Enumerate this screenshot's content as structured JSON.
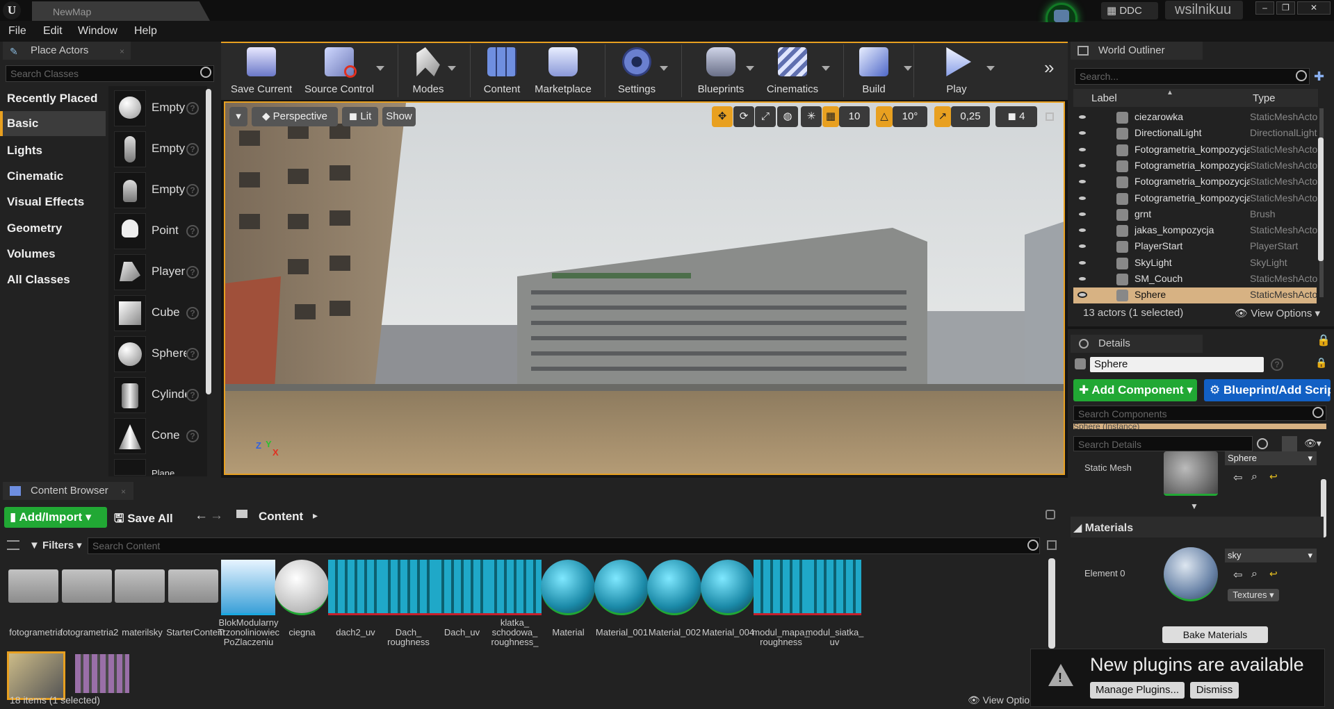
{
  "titlebar": {
    "map_tab": "NewMap",
    "ddc": "DDC",
    "user": "wsilnikuu",
    "win_min": "–",
    "win_max": "❐",
    "win_close": "✕"
  },
  "menu": [
    "File",
    "Edit",
    "Window",
    "Help"
  ],
  "place_actors": {
    "title": "Place Actors",
    "search_placeholder": "Search Classes",
    "categories": [
      "Recently Placed",
      "Basic",
      "Lights",
      "Cinematic",
      "Visual Effects",
      "Geometry",
      "Volumes",
      "All Classes"
    ],
    "selected_category": "Basic",
    "actors": [
      "Empty",
      "Empty",
      "Empty",
      "Point",
      "Player",
      "Cube",
      "Sphere",
      "Cylinder",
      "Cone",
      "Plane"
    ]
  },
  "toolbar": {
    "buttons": [
      "Save Current",
      "Source Control",
      "Modes",
      "Content",
      "Marketplace",
      "Settings",
      "Blueprints",
      "Cinematics",
      "Build",
      "Play"
    ],
    "more": "»"
  },
  "viewport": {
    "perspective": "Perspective",
    "lit": "Lit",
    "show": "Show",
    "grid_snap": "10",
    "rotation_snap": "10°",
    "scale_snap": "0,25",
    "camera_speed": "4",
    "axis_x": "X",
    "axis_y": "Y",
    "axis_z": "Z"
  },
  "content_browser": {
    "title": "Content Browser",
    "add_import": "Add/Import",
    "save_all": "Save All",
    "path": "Content",
    "filters": "Filters",
    "search_placeholder": "Search Content",
    "assets": [
      {
        "name": "fotogrametria",
        "kind": "folder"
      },
      {
        "name": "fotogrametria2",
        "kind": "folder"
      },
      {
        "name": "materilsky",
        "kind": "folder"
      },
      {
        "name": "StarterContent",
        "kind": "folder"
      },
      {
        "name": "BlokModularny Trzonoliniowiec PoZlaczeniu",
        "kind": "mesh"
      },
      {
        "name": "ciegna",
        "kind": "sphere"
      },
      {
        "name": "dach2_uv",
        "kind": "texture"
      },
      {
        "name": "Dach_ roughness",
        "kind": "texture"
      },
      {
        "name": "Dach_uv",
        "kind": "texture"
      },
      {
        "name": "klatka_ schodowa_ roughness_",
        "kind": "texture"
      },
      {
        "name": "Material",
        "kind": "material"
      },
      {
        "name": "Material_001",
        "kind": "material"
      },
      {
        "name": "Material_002",
        "kind": "material"
      },
      {
        "name": "Material_004",
        "kind": "material"
      },
      {
        "name": "modul_mapa_ roughness",
        "kind": "texture"
      },
      {
        "name": "modul_siatka_ uv",
        "kind": "texture"
      }
    ],
    "status": "18 items (1 selected)",
    "view_options": "View Options"
  },
  "outliner": {
    "title": "World Outliner",
    "search_placeholder": "Search...",
    "col_label": "Label",
    "col_type": "Type",
    "rows": [
      {
        "label": "ciezarowka",
        "type": "StaticMeshActor"
      },
      {
        "label": "DirectionalLight",
        "type": "DirectionalLight"
      },
      {
        "label": "Fotogrametria_kompozycja",
        "type": "StaticMeshActor"
      },
      {
        "label": "Fotogrametria_kompozycja",
        "type": "StaticMeshActor"
      },
      {
        "label": "Fotogrametria_kompozycja",
        "type": "StaticMeshActor"
      },
      {
        "label": "Fotogrametria_kompozycja",
        "type": "StaticMeshActor"
      },
      {
        "label": "grnt",
        "type": "Brush"
      },
      {
        "label": "jakas_kompozycja",
        "type": "StaticMeshActor"
      },
      {
        "label": "PlayerStart",
        "type": "PlayerStart"
      },
      {
        "label": "SkyLight",
        "type": "SkyLight"
      },
      {
        "label": "SM_Couch",
        "type": "StaticMeshActor"
      },
      {
        "label": "Sphere",
        "type": "StaticMeshActor"
      }
    ],
    "selected_row": 11,
    "status": "13 actors (1 selected)",
    "view_options": "View Options"
  },
  "details": {
    "title": "Details",
    "name_value": "Sphere",
    "add_component": "Add Component",
    "blueprint": "Blueprint/Add Script",
    "search_components": "Search Components",
    "component_item": "Sphere (Instance)",
    "search_details": "Search Details",
    "static_mesh_label": "Static Mesh",
    "static_mesh_value": "Sphere",
    "materials_header": "Materials",
    "element0_label": "Element 0",
    "element0_value": "sky",
    "textures": "Textures",
    "bake_materials": "Bake Materials"
  },
  "notification": {
    "message": "New plugins are available",
    "manage": "Manage Plugins...",
    "dismiss": "Dismiss"
  },
  "colors": {
    "accent": "#e8a020",
    "green": "#21a834",
    "blue": "#1260c4",
    "selection": "#d7b283"
  }
}
